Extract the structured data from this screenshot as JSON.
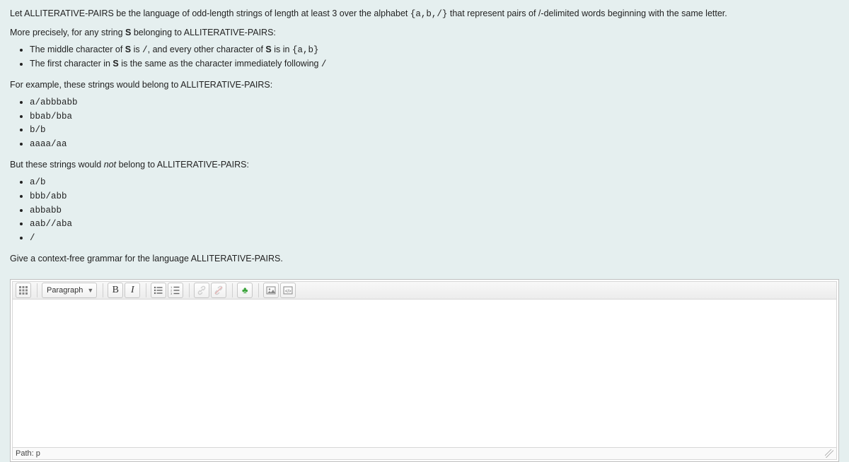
{
  "content": {
    "p1_a": "Let ALLITERATIVE-PAIRS be the language of odd-length strings of length at least 3 over the alphabet ",
    "p1_code": "{a,b,/}",
    "p1_b": " that represent pairs of /-delimited words beginning with the same letter.",
    "p2_a": "More precisely, for any string ",
    "p2_b": "S",
    "p2_c": " belonging to ALLITERATIVE-PAIRS:",
    "rule1_a": "The middle character of ",
    "rule1_b": "S",
    "rule1_c": " is ",
    "rule1_code1": "/",
    "rule1_d": ", and every other character of ",
    "rule1_e": "S",
    "rule1_f": " is in ",
    "rule1_code2": "{a,b}",
    "rule2_a": "The first character in ",
    "rule2_b": "S",
    "rule2_c": " is the same as the character immediately following ",
    "rule2_code": "/",
    "ex_in_intro": "For example, these strings would belong to ALLITERATIVE-PAIRS:",
    "ex_in": [
      "a/abbbabb",
      "bbab/bba",
      "b/b",
      "aaaa/aa"
    ],
    "ex_out_a": "But these strings would ",
    "ex_out_em": "not",
    "ex_out_b": " belong to ALLITERATIVE-PAIRS:",
    "ex_out": [
      "a/b",
      "bbb/abb",
      "abbabb",
      "aab//aba",
      "/"
    ],
    "task": "Give a context-free grammar for the language ALLITERATIVE-PAIRS."
  },
  "editor": {
    "format_label": "Paragraph",
    "bold": "B",
    "italic": "I",
    "path_label": "Path: p"
  }
}
